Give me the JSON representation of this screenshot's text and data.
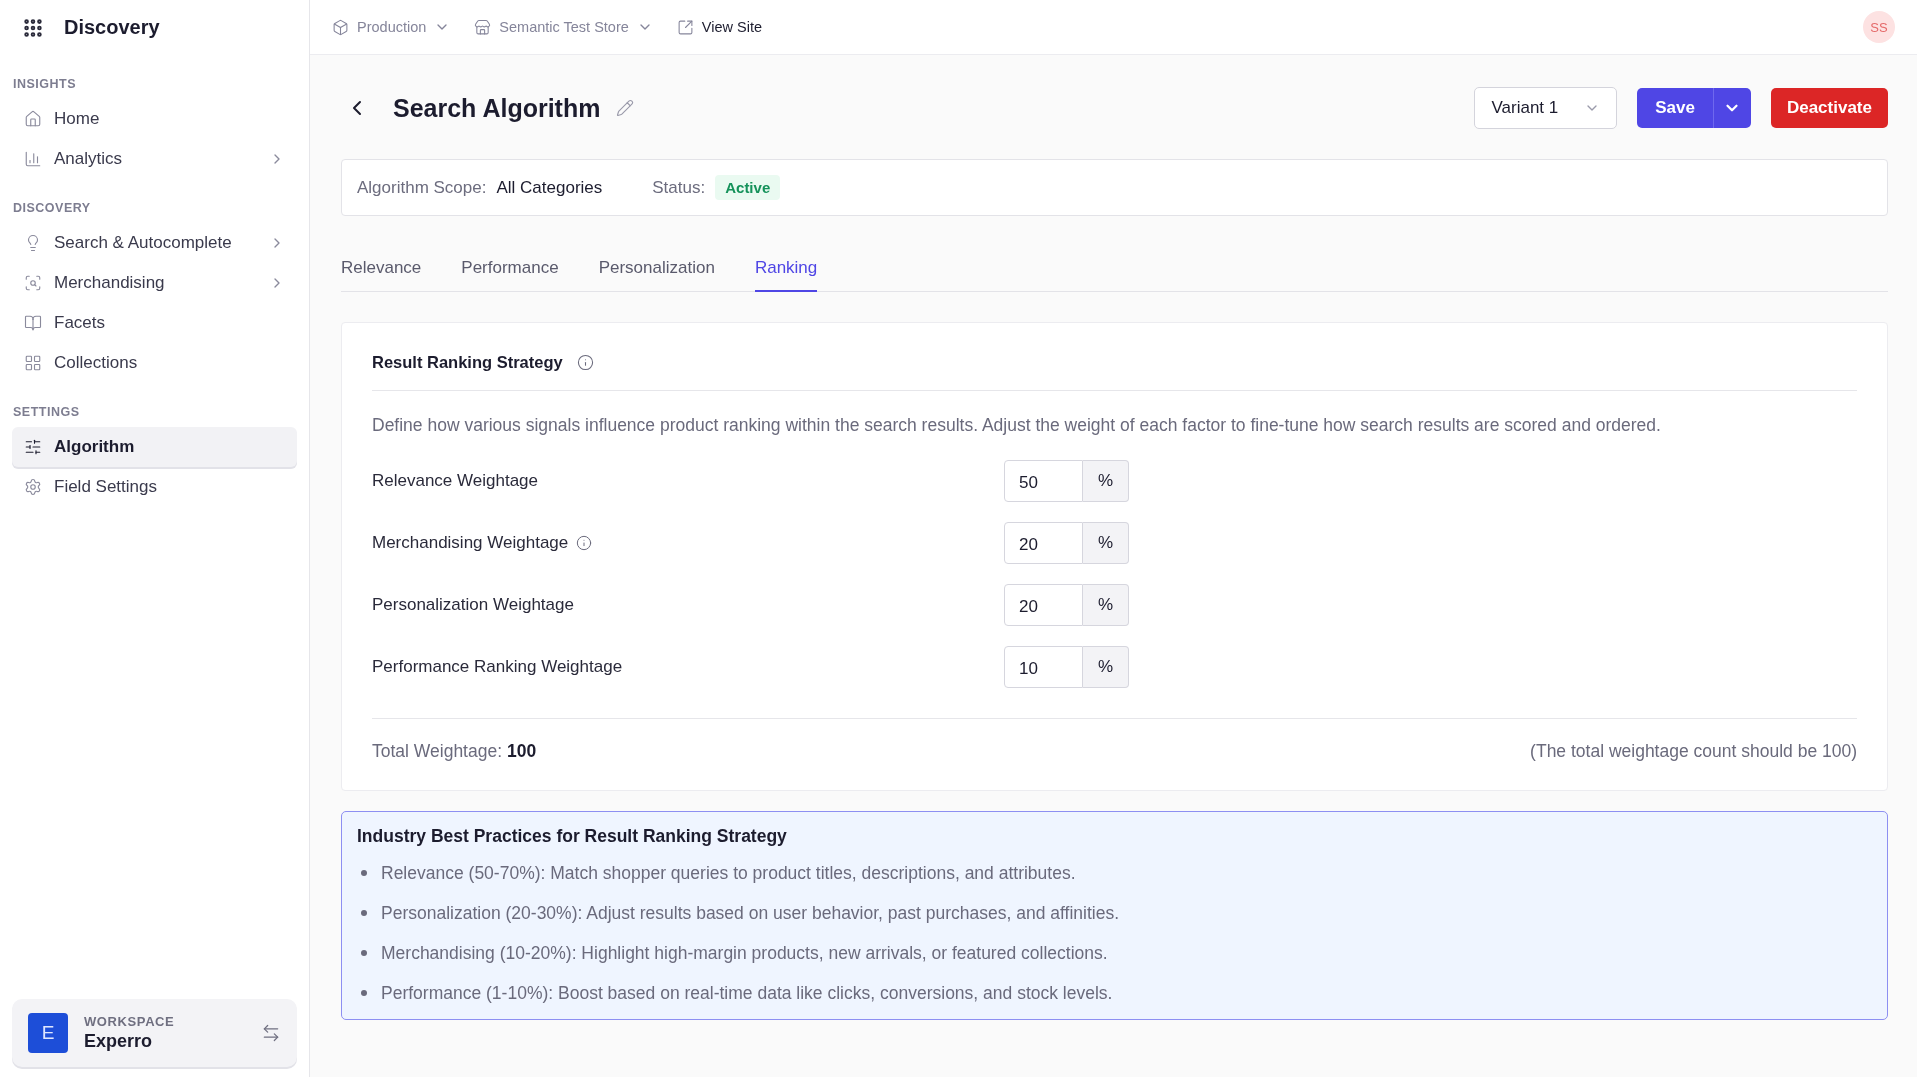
{
  "app": {
    "title": "Discovery"
  },
  "sidebar": {
    "sections": [
      {
        "heading": "INSIGHTS",
        "items": [
          {
            "label": "Home",
            "has_submenu": false,
            "selected": false
          },
          {
            "label": "Analytics",
            "has_submenu": true,
            "selected": false
          }
        ]
      },
      {
        "heading": "DISCOVERY",
        "items": [
          {
            "label": "Search & Autocomplete",
            "has_submenu": true,
            "selected": false
          },
          {
            "label": "Merchandising",
            "has_submenu": true,
            "selected": false
          },
          {
            "label": "Facets",
            "has_submenu": false,
            "selected": false
          },
          {
            "label": "Collections",
            "has_submenu": false,
            "selected": false
          }
        ]
      },
      {
        "heading": "SETTINGS",
        "items": [
          {
            "label": "Algorithm",
            "has_submenu": false,
            "selected": true
          },
          {
            "label": "Field Settings",
            "has_submenu": false,
            "selected": false
          }
        ]
      }
    ],
    "workspace": {
      "label": "WORKSPACE",
      "name": "Experro",
      "initial": "E"
    }
  },
  "topbar": {
    "environment": "Production",
    "store": "Semantic Test Store",
    "view_site": "View Site",
    "avatar": "SS"
  },
  "header": {
    "title": "Search Algorithm",
    "variant": "Variant 1",
    "save": "Save",
    "deactivate": "Deactivate"
  },
  "scope": {
    "scope_label": "Algorithm Scope:",
    "scope_value": "All Categories",
    "status_label": "Status:",
    "status": "Active"
  },
  "tabs": [
    {
      "label": "Relevance",
      "selected": false
    },
    {
      "label": "Performance",
      "selected": false
    },
    {
      "label": "Personalization",
      "selected": false
    },
    {
      "label": "Ranking",
      "selected": true
    }
  ],
  "strategy": {
    "title": "Result Ranking Strategy",
    "description": "Define how various signals influence product ranking within the search results. Adjust the weight of each factor to fine-tune how search results are scored and ordered.",
    "fields": [
      {
        "label": "Relevance Weightage",
        "value": "50",
        "unit": "%",
        "has_info": false
      },
      {
        "label": "Merchandising Weightage",
        "value": "20",
        "unit": "%",
        "has_info": true
      },
      {
        "label": "Personalization Weightage",
        "value": "20",
        "unit": "%",
        "has_info": false
      },
      {
        "label": "Performance Ranking Weightage",
        "value": "10",
        "unit": "%",
        "has_info": false
      }
    ],
    "total_label": "Total Weightage:",
    "total": "100",
    "note": "(The total weightage count should be 100)"
  },
  "best_practices": {
    "title": "Industry Best Practices for Result Ranking Strategy",
    "items": [
      "Relevance (50-70%): Match shopper queries to product titles, descriptions, and attributes.",
      "Personalization (20-30%): Adjust results based on user behavior, past purchases, and affinities.",
      "Merchandising (10-20%): Highlight high-margin products, new arrivals, or featured collections.",
      "Performance (1-10%): Boost based on real-time data like clicks, conversions, and stock levels."
    ]
  }
}
